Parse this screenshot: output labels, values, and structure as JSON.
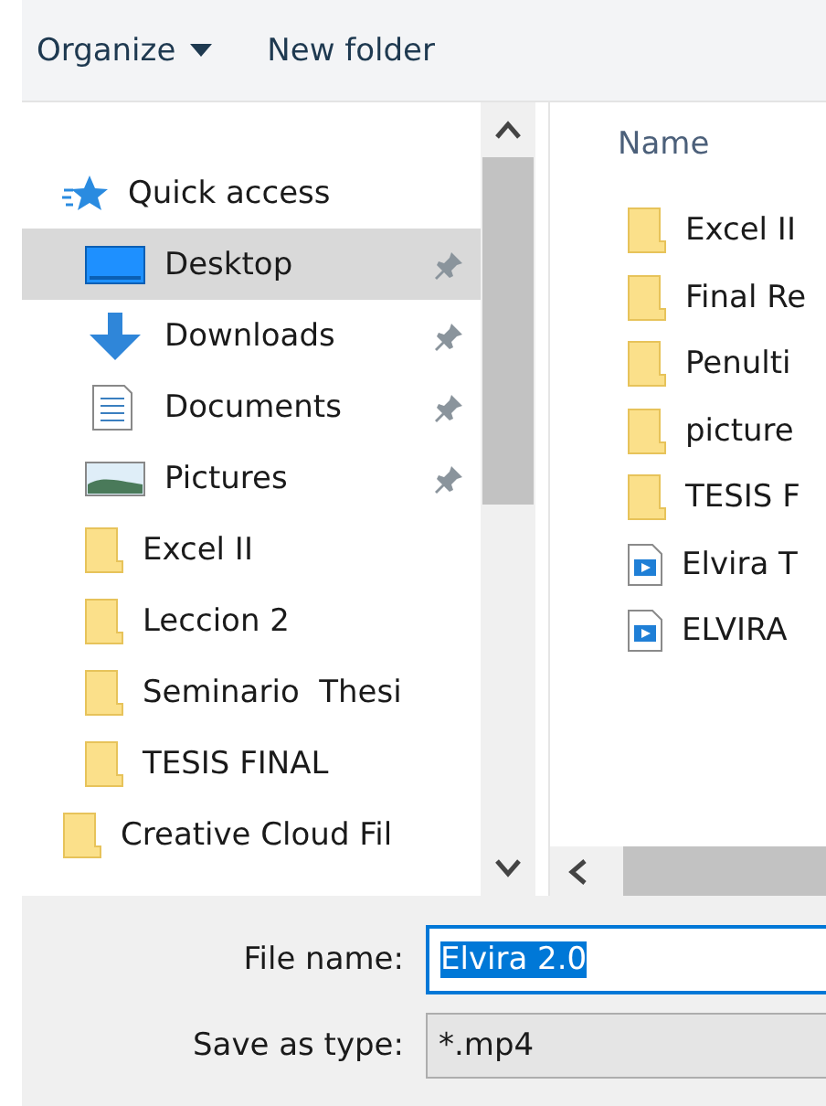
{
  "toolbar": [
    {
      "label": "Organize",
      "kind": "menu"
    },
    {
      "label": "New folder",
      "kind": "button"
    }
  ],
  "nav": {
    "items": [
      {
        "label": "Quick access",
        "kind": "star",
        "selected": false,
        "children": [
          {
            "label": "Desktop",
            "kind": "desktop",
            "pinned": true,
            "selected": true
          },
          {
            "label": "Downloads",
            "kind": "download",
            "pinned": true,
            "selected": false
          },
          {
            "label": "Documents",
            "kind": "document",
            "pinned": true,
            "selected": false
          },
          {
            "label": "Pictures",
            "kind": "pictures",
            "pinned": true,
            "selected": false
          },
          {
            "label": "Excel II",
            "kind": "folder",
            "pinned": false,
            "selected": false
          },
          {
            "label": "Leccion 2",
            "kind": "folder",
            "pinned": false,
            "selected": false
          },
          {
            "label": "Seminario  Thesi",
            "kind": "folder",
            "pinned": false,
            "selected": false
          },
          {
            "label": "TESIS FINAL",
            "kind": "folder",
            "pinned": false,
            "selected": false
          }
        ]
      },
      {
        "label": "Creative Cloud Fil",
        "kind": "folder",
        "selected": false
      }
    ]
  },
  "files": {
    "column": "Name",
    "rows": [
      {
        "name": "Excel II",
        "kind": "folder"
      },
      {
        "name": "Final Re",
        "kind": "folder"
      },
      {
        "name": "Penulti",
        "kind": "folder"
      },
      {
        "name": "picture",
        "kind": "folder"
      },
      {
        "name": "TESIS F",
        "kind": "folder"
      },
      {
        "name": "Elvira T",
        "kind": "video"
      },
      {
        "name": "ELVIRA",
        "kind": "video"
      }
    ]
  },
  "form": {
    "file_name_label": "File name:",
    "file_name": "Elvira 2.0",
    "type_label": "Save as type:",
    "type": "*.mp4"
  }
}
